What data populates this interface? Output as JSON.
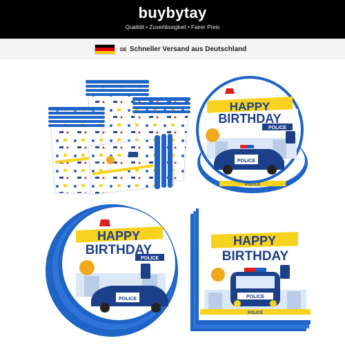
{
  "header": {
    "brand": "buybytay",
    "tagline": "Qualität • Zuverlässigkeit • Fairer Preis"
  },
  "shipping": {
    "country_code": "DE",
    "message": "Schneller Versand aus Deutschland",
    "flag_colors": [
      "#000000",
      "#dd0000",
      "#ffce00"
    ]
  },
  "product": {
    "plate_large": {
      "line1": "HAPPY",
      "line2": "BIRTHDAY",
      "tag": "POLICE",
      "car_text": "POLICE",
      "tape_text": "POLICE"
    },
    "plate_small": {
      "line1": "HAPPY",
      "line2": "BIRTHDAY",
      "tag": "POLICE",
      "car_text": "POLICE"
    },
    "napkin": {
      "line1": "HAPPY",
      "line2": "BIRTHDAY",
      "car_text": "POLICE",
      "tape_text": "POLICE"
    },
    "colors": {
      "accent_blue": "#1e63c6",
      "banner_yellow": "#f7d21e",
      "banner_text": "#1c3f8a",
      "siren_red": "#e02020"
    }
  }
}
